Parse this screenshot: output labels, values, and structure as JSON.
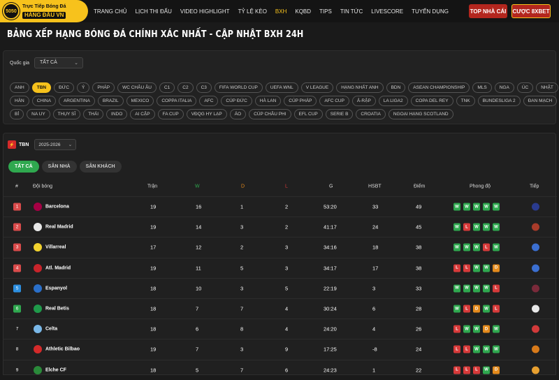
{
  "brand": {
    "line1": "Trực Tiếp Bóng Đá",
    "line2": "HÀNG ĐẦU VN",
    "badge": "5050"
  },
  "nav": [
    "TRANG CHỦ",
    "LỊCH THI ĐẤU",
    "VIDEO HIGHLIGHT",
    "TỶ LỆ KÈO",
    "BXH",
    "KQBD",
    "TIPS",
    "TIN TỨC",
    "LIVESCORE",
    "TUYỂN DỤNG"
  ],
  "nav_active": "BXH",
  "buttons": {
    "top_nha_cai": "TOP NHÀ CÁI",
    "cuoc": "CƯỢC 8XBET"
  },
  "page_title": "BẢNG XẾP HẠNG BÓNG ĐÁ CHÍNH XÁC NHẤT - CẬP NHẬT BXH 24H",
  "country": {
    "label": "Quốc gia",
    "value": "TẤT CẢ"
  },
  "chips": [
    [
      "ANH",
      "TBN",
      "ĐỨC",
      "Ý",
      "PHÁP",
      "WC CHÂU ÂU",
      "C1",
      "C2",
      "C3",
      "FIFA WORLD CUP",
      "UEFA WNL",
      "V LEAGUE",
      "HẠNG NHẤT ANH",
      "BDN",
      "ASEAN CHAMPIONSHIP",
      "MLS",
      "NGA",
      "ÚC",
      "NHẬT"
    ],
    [
      "HÀN",
      "CHINA",
      "ARGENTINA",
      "BRAZIL",
      "MEXICO",
      "COPPA ITALIA",
      "AFC",
      "CÚP ĐỨC",
      "HÀ LAN",
      "CÚP PHÁP",
      "AFC CUP",
      "Ả-RẬP",
      "LA LIGA2",
      "COPA DEL REY",
      "TNK",
      "BUNDESLIGA 2",
      "ĐAN MẠCH"
    ],
    [
      "BỈ",
      "NA UY",
      "THỤY SĨ",
      "THÁI",
      "INDO",
      "AI CẬP",
      "FA CUP",
      "VĐQG HY LẠP",
      "ÁO",
      "CÚP CHÂU PHI",
      "EFL CUP",
      "SERIE B",
      "CROATIA",
      "NGOẠI HẠNG SCOTLAND"
    ]
  ],
  "chip_active": "TBN",
  "league": {
    "name": "TBN",
    "season": "2025-2026"
  },
  "tabs": [
    "TẤT CẢ",
    "SÂN NHÀ",
    "SÂN KHÁCH"
  ],
  "tab_active": "TẤT CẢ",
  "columns": {
    "rank": "#",
    "team": "Đội bóng",
    "played": "Trận",
    "w": "W",
    "d": "D",
    "l": "L",
    "g": "G",
    "gd": "HSBT",
    "pts": "Điểm",
    "form": "Phong độ",
    "next": "Tiếp"
  },
  "colors": {
    "accent": "#f7c21c",
    "win": "#2fa84f",
    "draw": "#e48a1c",
    "loss": "#d73a3a",
    "cl": "#d94b4b",
    "el": "#2d8fe0",
    "conf": "#2fa84f"
  },
  "standings": [
    {
      "rank": "1",
      "team": "Barcelona",
      "played": "19",
      "w": "16",
      "d": "1",
      "l": "2",
      "g": "53:20",
      "gd": "33",
      "pts": "49",
      "form": [
        "W",
        "W",
        "W",
        "W",
        "W"
      ],
      "zone": "cl",
      "crest": "#a50044",
      "next": "#2a3b8f"
    },
    {
      "rank": "2",
      "team": "Real Madrid",
      "played": "19",
      "w": "14",
      "d": "3",
      "l": "2",
      "g": "41:17",
      "gd": "24",
      "pts": "45",
      "form": [
        "W",
        "L",
        "W",
        "W",
        "W"
      ],
      "zone": "cl",
      "crest": "#e8e8e8",
      "next": "#a83b2a"
    },
    {
      "rank": "3",
      "team": "Villarreal",
      "played": "17",
      "w": "12",
      "d": "2",
      "l": "3",
      "g": "34:16",
      "gd": "18",
      "pts": "38",
      "form": [
        "W",
        "W",
        "W",
        "L",
        "W"
      ],
      "zone": "cl",
      "crest": "#f2d22e",
      "next": "#3b6fd1"
    },
    {
      "rank": "4",
      "team": "Atl. Madrid",
      "played": "19",
      "w": "11",
      "d": "5",
      "l": "3",
      "g": "34:17",
      "gd": "17",
      "pts": "38",
      "form": [
        "L",
        "L",
        "W",
        "W",
        "D"
      ],
      "zone": "cl",
      "crest": "#c8242b",
      "next": "#3b6fd1"
    },
    {
      "rank": "5",
      "team": "Espanyol",
      "played": "18",
      "w": "10",
      "d": "3",
      "l": "5",
      "g": "22:19",
      "gd": "3",
      "pts": "33",
      "form": [
        "W",
        "W",
        "W",
        "W",
        "L"
      ],
      "zone": "el",
      "crest": "#2a6fc9",
      "next": "#7a2a3a"
    },
    {
      "rank": "6",
      "team": "Real Betis",
      "played": "18",
      "w": "7",
      "d": "7",
      "l": "4",
      "g": "30:24",
      "gd": "6",
      "pts": "28",
      "form": [
        "W",
        "L",
        "D",
        "W",
        "L"
      ],
      "zone": "conf",
      "crest": "#1f9a4a",
      "next": "#e8e8e8"
    },
    {
      "rank": "7",
      "team": "Celta",
      "played": "18",
      "w": "6",
      "d": "8",
      "l": "4",
      "g": "24:20",
      "gd": "4",
      "pts": "26",
      "form": [
        "L",
        "W",
        "W",
        "D",
        "W"
      ],
      "zone": "",
      "crest": "#7ab8e8",
      "next": "#d13a3a"
    },
    {
      "rank": "8",
      "team": "Athletic Bilbao",
      "played": "19",
      "w": "7",
      "d": "3",
      "l": "9",
      "g": "17:25",
      "gd": "-8",
      "pts": "24",
      "form": [
        "L",
        "L",
        "W",
        "W",
        "W"
      ],
      "zone": "",
      "crest": "#d42a2a",
      "next": "#d87a1a"
    },
    {
      "rank": "9",
      "team": "Elche CF",
      "played": "18",
      "w": "5",
      "d": "7",
      "l": "6",
      "g": "24:23",
      "gd": "1",
      "pts": "22",
      "form": [
        "L",
        "L",
        "L",
        "W",
        "D"
      ],
      "zone": "",
      "crest": "#2a8a3a",
      "next": "#e8a030"
    }
  ]
}
